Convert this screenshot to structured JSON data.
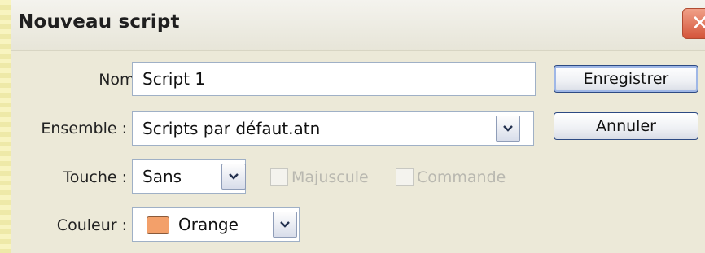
{
  "dialog": {
    "title": "Nouveau script",
    "close_symbol": "✕"
  },
  "form": {
    "name_label": "Nom :",
    "name_value": "Script 1",
    "set_label": "Ensemble :",
    "set_value": "Scripts par défaut.atn",
    "key_label": "Touche :",
    "key_value": "Sans",
    "shift_label": "Majuscule",
    "shift_checked": false,
    "shift_enabled": false,
    "command_label": "Commande",
    "command_checked": false,
    "command_enabled": false,
    "color_label": "Couleur :",
    "color_value": "Orange",
    "color_swatch": "#f3a06a"
  },
  "buttons": {
    "save_label": "Enregistrer",
    "cancel_label": "Annuler"
  },
  "icons": {
    "close": "close-icon",
    "dropdown": "chevron-down-icon"
  },
  "colors": {
    "title_close_bg": "#d4553a",
    "button_border": "#2d4a83",
    "field_border": "#9fb0c6"
  }
}
